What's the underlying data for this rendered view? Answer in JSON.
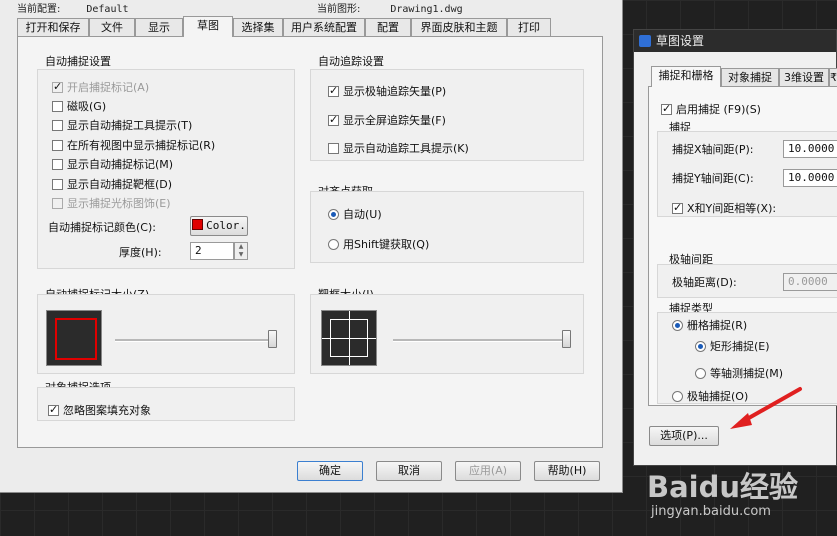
{
  "main_dialog": {
    "current_profile_label": "当前配置:",
    "current_profile_value": "Default",
    "current_drawing_label": "当前图形:",
    "current_drawing_value": "Drawing1.dwg",
    "tabs": [
      "打开和保存",
      "文件",
      "显示",
      "草图",
      "选择集",
      "用户系统配置",
      "配置",
      "界面皮肤和主题",
      "打印"
    ],
    "autosnap": {
      "title": "自动捕捉设置",
      "options": [
        {
          "label": "开启捕捉标记(A)",
          "checked": true,
          "disabled": true
        },
        {
          "label": "磁吸(G)",
          "checked": false,
          "disabled": false
        },
        {
          "label": "显示自动捕捉工具提示(T)",
          "checked": false,
          "disabled": false
        },
        {
          "label": "在所有视图中显示捕捉标记(R)",
          "checked": false,
          "disabled": false
        },
        {
          "label": "显示自动捕捉标记(M)",
          "checked": false,
          "disabled": false
        },
        {
          "label": "显示自动捕捉靶框(D)",
          "checked": false,
          "disabled": false
        },
        {
          "label": "显示捕捉光标图饰(E)",
          "checked": false,
          "disabled": true
        }
      ],
      "color_label": "自动捕捉标记颜色(C):",
      "color_button": "Color.",
      "color_value": "#e00000",
      "thickness_label": "厚度(H):",
      "thickness_value": "2"
    },
    "autotrack": {
      "title": "自动追踪设置",
      "options": [
        {
          "label": "显示极轴追踪矢量(P)",
          "checked": true
        },
        {
          "label": "显示全屏追踪矢量(F)",
          "checked": true
        },
        {
          "label": "显示自动追踪工具提示(K)",
          "checked": false
        }
      ]
    },
    "alignment": {
      "title": "对齐点获取",
      "options": [
        {
          "label": "自动(U)",
          "selected": true
        },
        {
          "label": "用Shift键获取(Q)",
          "selected": false
        }
      ]
    },
    "marker_size": {
      "title": "自动捕捉标记大小(Z)",
      "level": 1.0
    },
    "aperture_size": {
      "title": "靶框大小(I)",
      "level": 1.0
    },
    "object_snap": {
      "title": "对象捕捉选项",
      "options": [
        {
          "label": "忽略图案填充对象",
          "checked": true
        }
      ]
    },
    "buttons": {
      "ok": "确定",
      "cancel": "取消",
      "apply": "应用(A)",
      "help": "帮助(H)"
    }
  },
  "drafting_dialog": {
    "title": "草图设置",
    "tabs": [
      "捕捉和栅格",
      "对象捕捉",
      "3维设置",
      "₹"
    ],
    "enable_snap": {
      "label": "启用捕捉 (F9)(S)",
      "checked": true
    },
    "snap_group": "捕捉",
    "snap_x_label": "捕捉X轴间距(P):",
    "snap_x_value": "10.0000",
    "snap_y_label": "捕捉Y轴间距(C):",
    "snap_y_value": "10.0000",
    "equal_xy": {
      "label": "X和Y间距相等(X):",
      "checked": true
    },
    "polar_group": "极轴间距",
    "polar_distance_label": "极轴距离(D):",
    "polar_distance_value": "0.0000",
    "snap_type_group": "捕捉类型",
    "snap_types": [
      {
        "label": "栅格捕捉(R)",
        "selected": true
      },
      {
        "label": "矩形捕捉(E)",
        "selected": true
      },
      {
        "label": "等轴测捕捉(M)",
        "selected": false
      },
      {
        "label": "极轴捕捉(O)",
        "selected": false
      }
    ],
    "options_button": "选项(P)...",
    "arrow_color": "#e02020"
  },
  "watermark": {
    "brand": "Baidu经验",
    "url": "jingyan.baidu.com"
  }
}
